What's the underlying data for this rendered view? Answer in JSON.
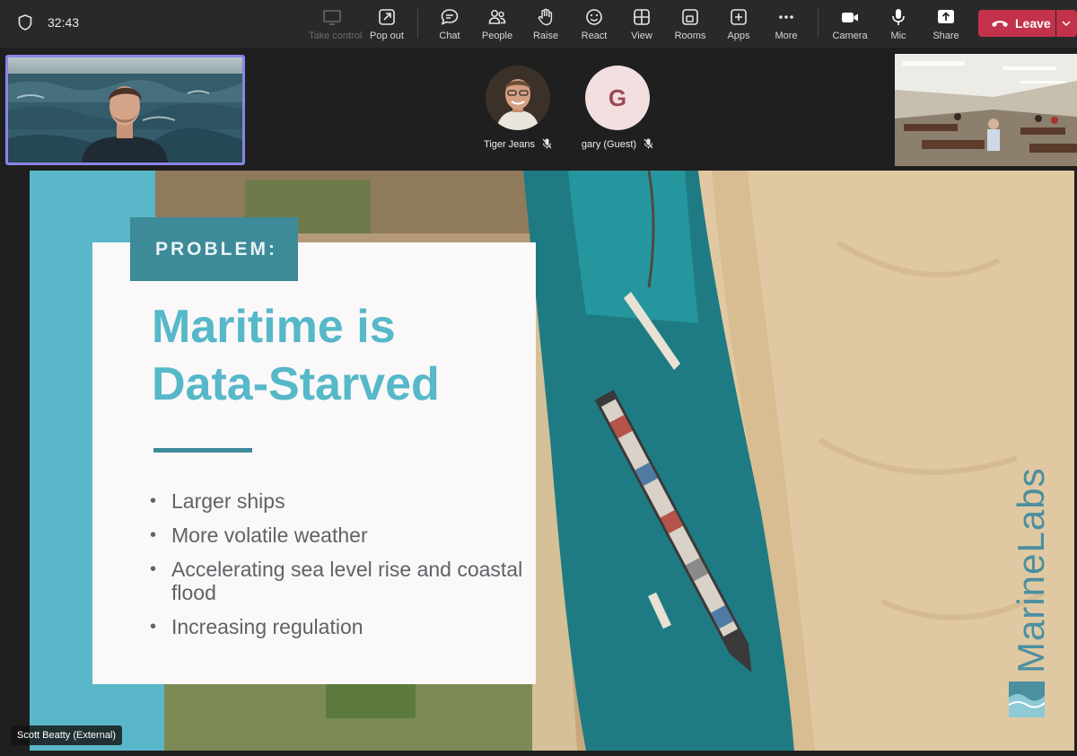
{
  "meeting": {
    "elapsed_time": "32:43"
  },
  "toolbar": {
    "buttons": [
      {
        "id": "take-control",
        "label": "Take control",
        "icon": "screen-cast-icon",
        "enabled": false
      },
      {
        "id": "pop-out",
        "label": "Pop out",
        "icon": "pop-out-icon",
        "enabled": true
      },
      {
        "id": "chat",
        "label": "Chat",
        "icon": "chat-bubble-icon",
        "enabled": true
      },
      {
        "id": "people",
        "label": "People",
        "icon": "people-icon",
        "enabled": true
      },
      {
        "id": "raise",
        "label": "Raise",
        "icon": "raise-hand-icon",
        "enabled": true
      },
      {
        "id": "react",
        "label": "React",
        "icon": "smiley-icon",
        "enabled": true
      },
      {
        "id": "view",
        "label": "View",
        "icon": "grid-icon",
        "enabled": true
      },
      {
        "id": "rooms",
        "label": "Rooms",
        "icon": "rooms-icon",
        "enabled": true
      },
      {
        "id": "apps",
        "label": "Apps",
        "icon": "plus-square-icon",
        "enabled": true
      },
      {
        "id": "more",
        "label": "More",
        "icon": "ellipsis-icon",
        "enabled": true
      },
      {
        "id": "camera",
        "label": "Camera",
        "icon": "video-camera-icon",
        "enabled": true
      },
      {
        "id": "mic",
        "label": "Mic",
        "icon": "microphone-icon",
        "enabled": true
      },
      {
        "id": "share",
        "label": "Share",
        "icon": "share-upload-icon",
        "enabled": true
      }
    ],
    "leave_label": "Leave",
    "leave_color": "#c4314b"
  },
  "participants": [
    {
      "name": "Tiger Jeans",
      "avatar": "photo",
      "muted": true
    },
    {
      "name": "gary (Guest)",
      "avatar_letter": "G",
      "muted": true
    }
  ],
  "presenter_caption": "Scott Beatty (External)",
  "slide": {
    "tag": "PROBLEM:",
    "headline_line1": "Maritime is",
    "headline_line2": "Data-Starved",
    "bullets": [
      "Larger ships",
      "More volatile weather",
      "Accelerating sea level rise and coastal flood",
      "Increasing regulation"
    ],
    "brand_part1": "Marine",
    "brand_part2": "Labs",
    "accent_color": "#3d8a99",
    "headline_color": "#56b8c9"
  }
}
